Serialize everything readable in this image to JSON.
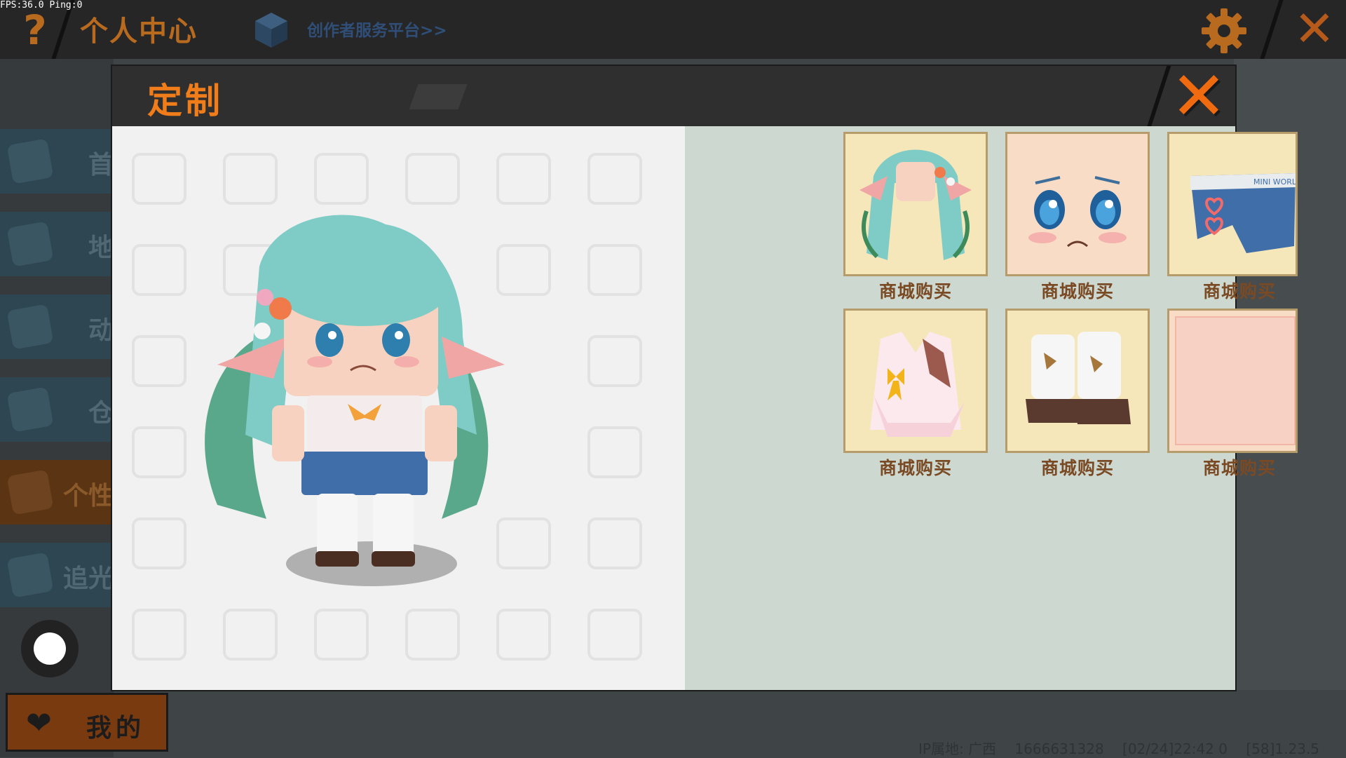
{
  "hud": {
    "fps_text": "FPS:36.0  Ping:0"
  },
  "topbar": {
    "help_label": "?",
    "title": "个人中心",
    "creator_link": "创作者服务平台>>",
    "close_label": "✕"
  },
  "sidebar": {
    "items": [
      {
        "label": "首",
        "icon": "home-icon"
      },
      {
        "label": "地",
        "icon": "map-icon"
      },
      {
        "label": "动",
        "icon": "bell-icon"
      },
      {
        "label": "仓",
        "icon": "warehouse-icon"
      },
      {
        "label": "个性",
        "icon": "avatar-icon",
        "active": true
      },
      {
        "label": "追光",
        "icon": "camera-icon"
      }
    ],
    "my_button": {
      "icon": "heart-icon",
      "label": "我的"
    }
  },
  "modal": {
    "title": "定制",
    "close_label": "✕",
    "items": [
      {
        "name": "hair",
        "buy_label": "商城购买"
      },
      {
        "name": "face",
        "buy_label": "商城购买"
      },
      {
        "name": "shorts",
        "buy_label": "商城购买"
      },
      {
        "name": "top",
        "buy_label": "商城购买"
      },
      {
        "name": "boots",
        "buy_label": "商城购买"
      },
      {
        "name": "skin",
        "buy_label": "商城购买"
      }
    ],
    "shorts_brand_text": "MINI WORLD"
  },
  "status": {
    "ip_location": "IP属地: 广西",
    "user_id": "1666631328",
    "timestamp": "[02/24]22:42 0",
    "version": "[58]1.23.5"
  },
  "colors": {
    "accent_orange": "#f07d1a",
    "title_brown": "#b86a1f",
    "item_background": "#f6e7ba",
    "panel_background": "#cdd8d0"
  }
}
